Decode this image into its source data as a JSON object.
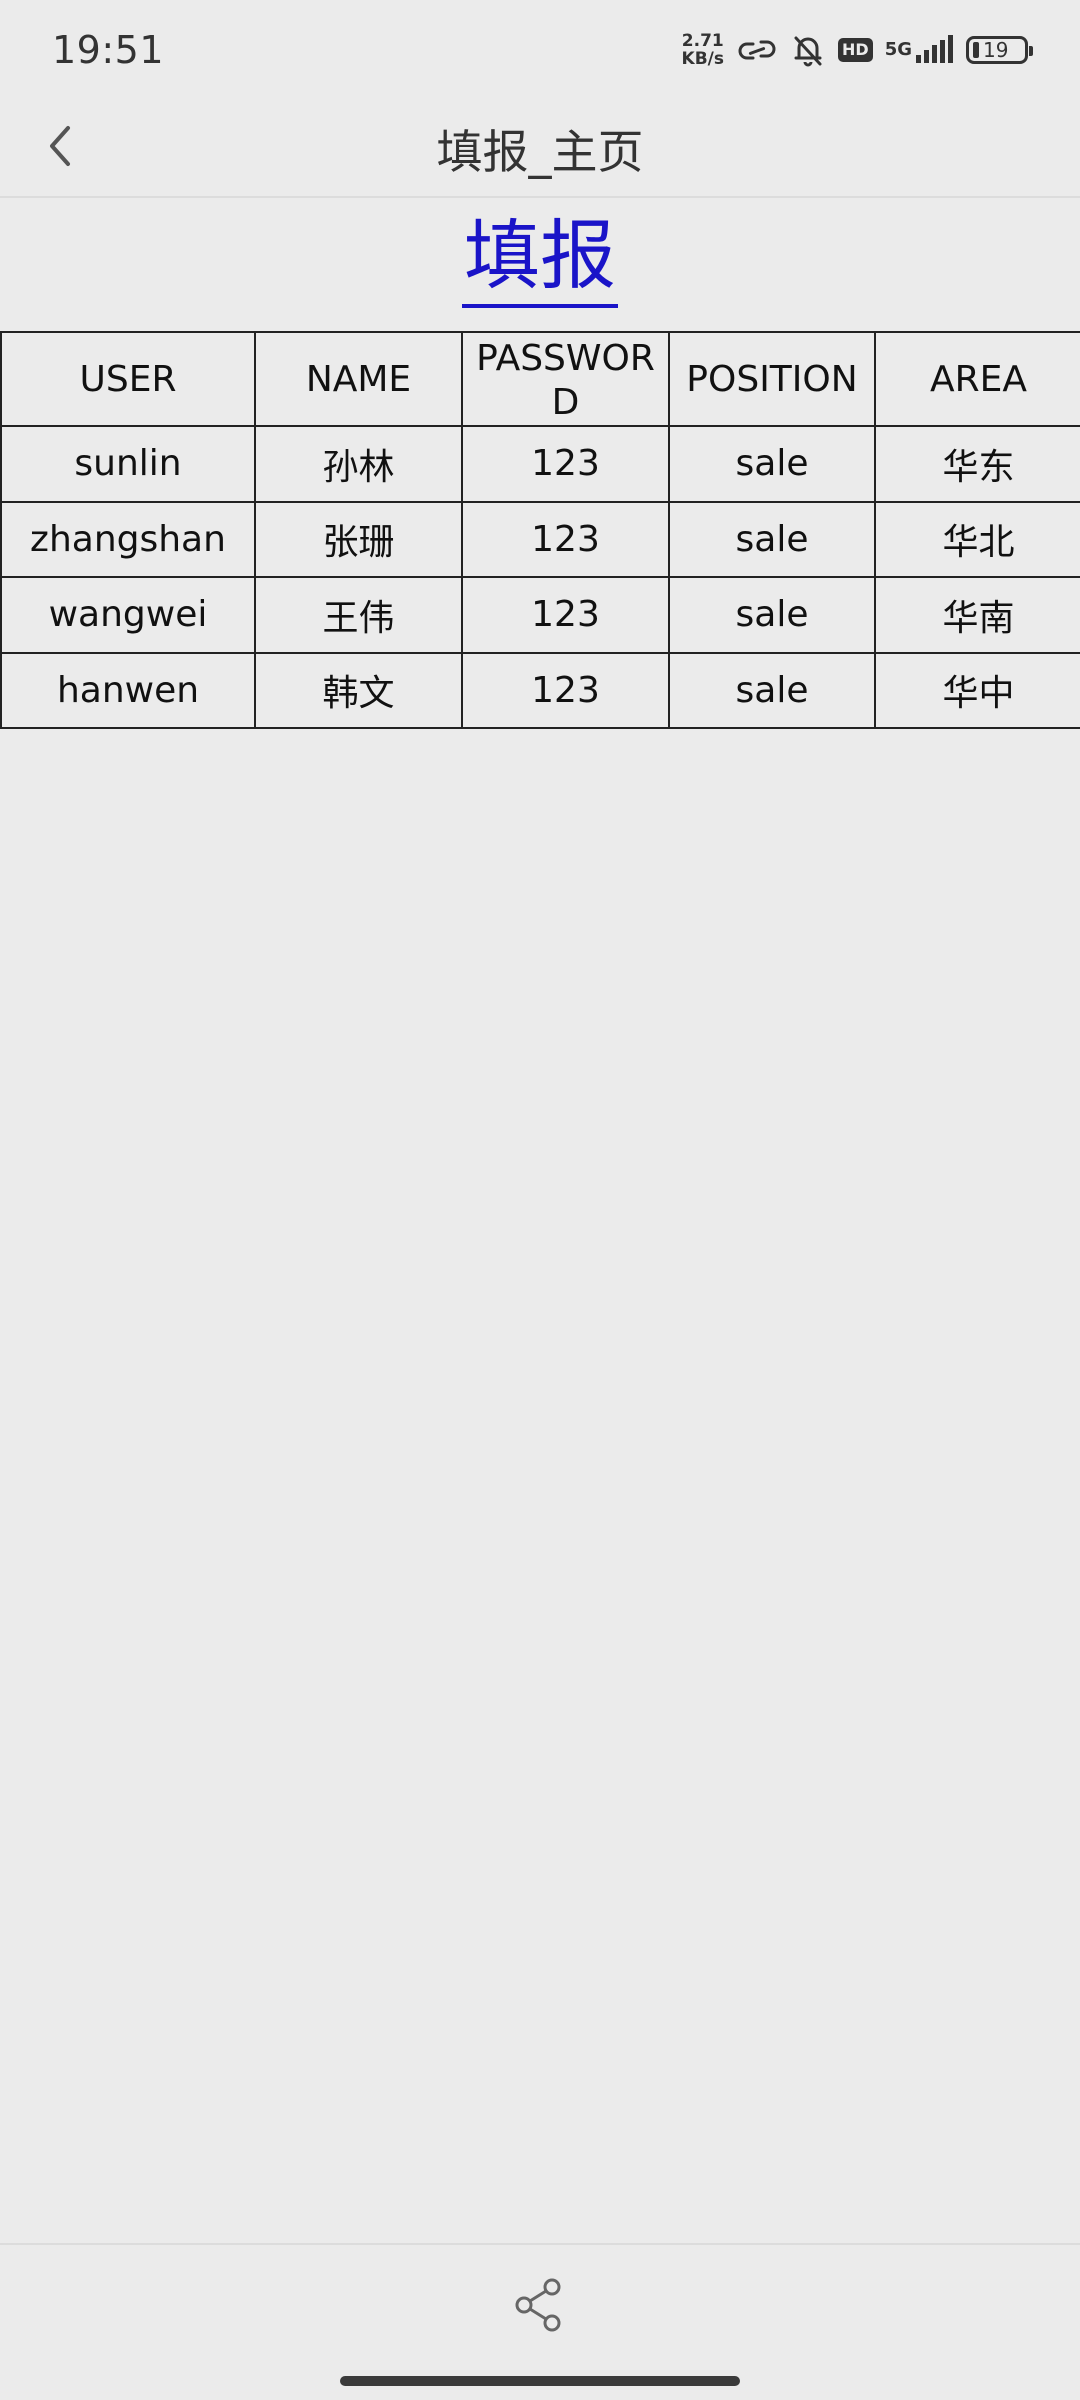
{
  "status_bar": {
    "time": "19:51",
    "net_speed_value": "2.71",
    "net_speed_unit": "KB/s",
    "hd": "HD",
    "network": "5G",
    "battery": "19"
  },
  "app_bar": {
    "title": "填报_主页",
    "back_icon": "chevron-left-icon"
  },
  "heading": "填报",
  "table": {
    "headers": [
      "USER",
      "NAME",
      "PASSWORD",
      "POSITION",
      "AREA"
    ],
    "rows": [
      [
        "sunlin",
        "孙林",
        "123",
        "sale",
        "华东"
      ],
      [
        "zhangshan",
        "张珊",
        "123",
        "sale",
        "华北"
      ],
      [
        "wangwei",
        "王伟",
        "123",
        "sale",
        "华南"
      ],
      [
        "hanwen",
        "韩文",
        "123",
        "sale",
        "华中"
      ]
    ]
  },
  "bottom_bar": {
    "share_icon": "share-icon"
  },
  "colors": {
    "background": "#ebebeb",
    "heading": "#1a14c8",
    "border": "#222222"
  }
}
